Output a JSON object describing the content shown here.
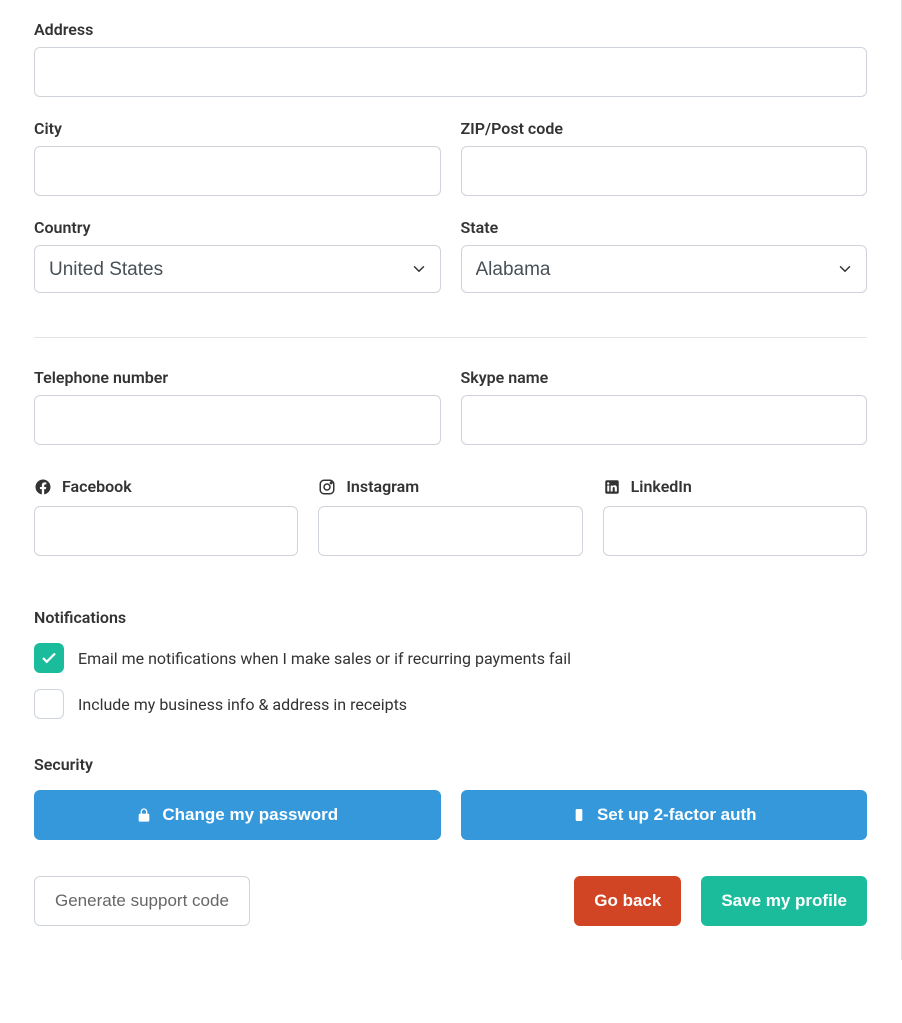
{
  "address": {
    "label": "Address",
    "value": ""
  },
  "city": {
    "label": "City",
    "value": ""
  },
  "zip": {
    "label": "ZIP/Post code",
    "value": ""
  },
  "country": {
    "label": "Country",
    "selected": "United States"
  },
  "state": {
    "label": "State",
    "selected": "Alabama"
  },
  "telephone": {
    "label": "Telephone number",
    "value": ""
  },
  "skype": {
    "label": "Skype name",
    "value": ""
  },
  "social": {
    "facebook": {
      "label": "Facebook",
      "value": ""
    },
    "instagram": {
      "label": "Instagram",
      "value": ""
    },
    "linkedin": {
      "label": "LinkedIn",
      "value": ""
    }
  },
  "notifications": {
    "heading": "Notifications",
    "email_sales": {
      "label": "Email me notifications when I make sales or if recurring payments fail",
      "checked": true
    },
    "include_business": {
      "label": "Include my business info & address in receipts",
      "checked": false
    }
  },
  "security": {
    "heading": "Security",
    "change_password_label": "Change my password",
    "two_factor_label": "Set up 2-factor auth"
  },
  "footer": {
    "support_code_label": "Generate support code",
    "go_back_label": "Go back",
    "save_label": "Save my profile"
  }
}
